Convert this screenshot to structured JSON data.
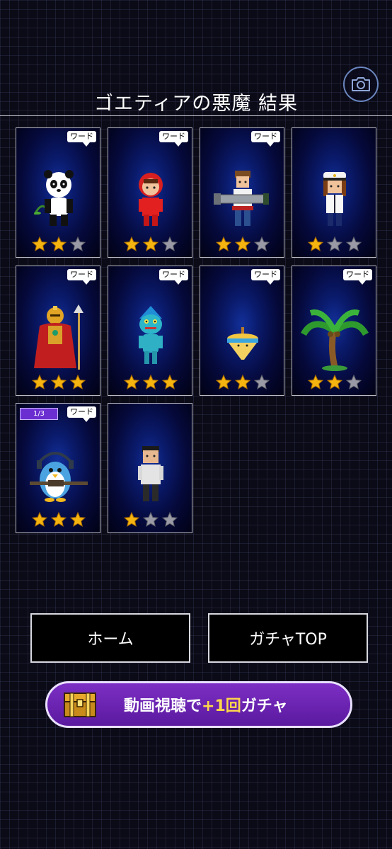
{
  "header": {
    "title": "ゴエティアの悪魔 結果"
  },
  "camera": {
    "icon": "camera-icon"
  },
  "cards": [
    {
      "character": "panda",
      "badge": "ワード",
      "stars": 2
    },
    {
      "character": "red-hood-kid",
      "badge": "ワード",
      "stars": 2
    },
    {
      "character": "boy-with-bazooka",
      "badge": "ワード",
      "stars": 2
    },
    {
      "character": "sailor-captain",
      "badge": "",
      "stars": 1
    },
    {
      "character": "red-armored-king",
      "badge": "ワード",
      "stars": 3
    },
    {
      "character": "fish-man",
      "badge": "ワード",
      "stars": 3
    },
    {
      "character": "spinning-top",
      "badge": "ワード",
      "stars": 2
    },
    {
      "character": "palm-tree",
      "badge": "ワード",
      "stars": 2
    },
    {
      "character": "penguin-sniper",
      "badge": "ワード",
      "count": "1/3",
      "stars": 3
    },
    {
      "character": "office-man",
      "badge": "",
      "stars": 1
    }
  ],
  "buttons": {
    "home": "ホーム",
    "gacha_top": "ガチャTOP"
  },
  "video_gacha": {
    "text_before": "動画視聴で",
    "highlight_plus1": "+1",
    "text_mid": "回",
    "text_after": "ガチャ",
    "icon": "treasure-chest-icon"
  },
  "colors": {
    "star_gold": "#f5b40f",
    "star_gray": "#9a9aa6",
    "gacha_purple": "#6a24b3",
    "highlight_yellow": "#ffd84a"
  }
}
